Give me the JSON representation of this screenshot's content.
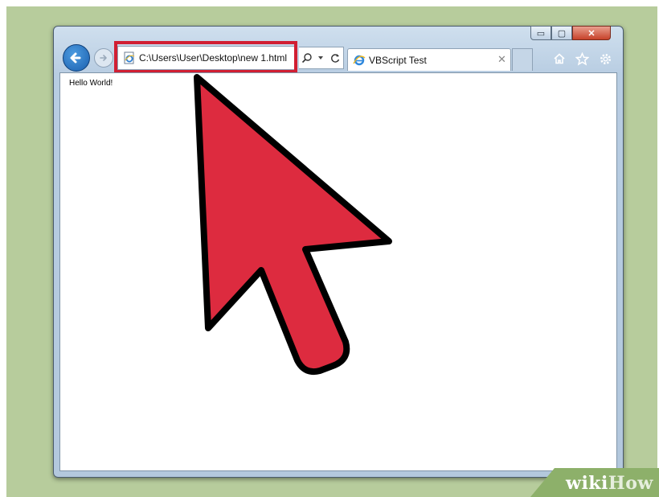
{
  "browser": {
    "address_bar": {
      "url": "C:\\Users\\User\\Desktop\\new  1.html"
    },
    "tab": {
      "title": "VBScript Test",
      "close_glyph": "✕"
    },
    "window_controls": {
      "minimize_glyph": "▭",
      "maximize_glyph": "▢",
      "close_glyph": "✕"
    },
    "address_tools": [
      "search-icon",
      "dropdown-arrow-icon",
      "refresh-icon"
    ],
    "toolbar_icons": [
      "home-icon",
      "favorites-star-icon",
      "settings-gear-icon"
    ]
  },
  "page": {
    "body_text": "Hello World!"
  },
  "overlay": {
    "cursor_color": "#dd2b3f",
    "highlight_color": "#d11f33"
  },
  "watermark": {
    "part1": "wiki",
    "part2": "How"
  }
}
